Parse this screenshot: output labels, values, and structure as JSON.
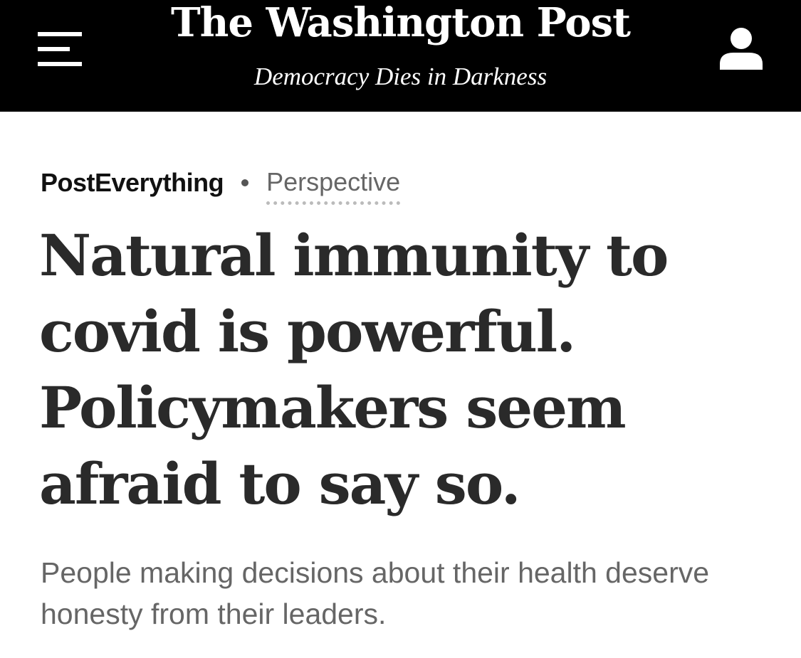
{
  "header": {
    "logo_text": "The Washington Post",
    "tagline": "Democracy Dies in Darkness",
    "menu_icon": "hamburger-menu-icon",
    "profile_icon": "user-profile-icon",
    "background_color": "#000000",
    "text_color": "#ffffff"
  },
  "article": {
    "section": "PostEverything",
    "label": "Perspective",
    "headline": "Natural immunity to covid is powerful. Policymakers seem afraid to say so.",
    "subheadline": "People making decisions about their health deserve honesty from their leaders."
  }
}
